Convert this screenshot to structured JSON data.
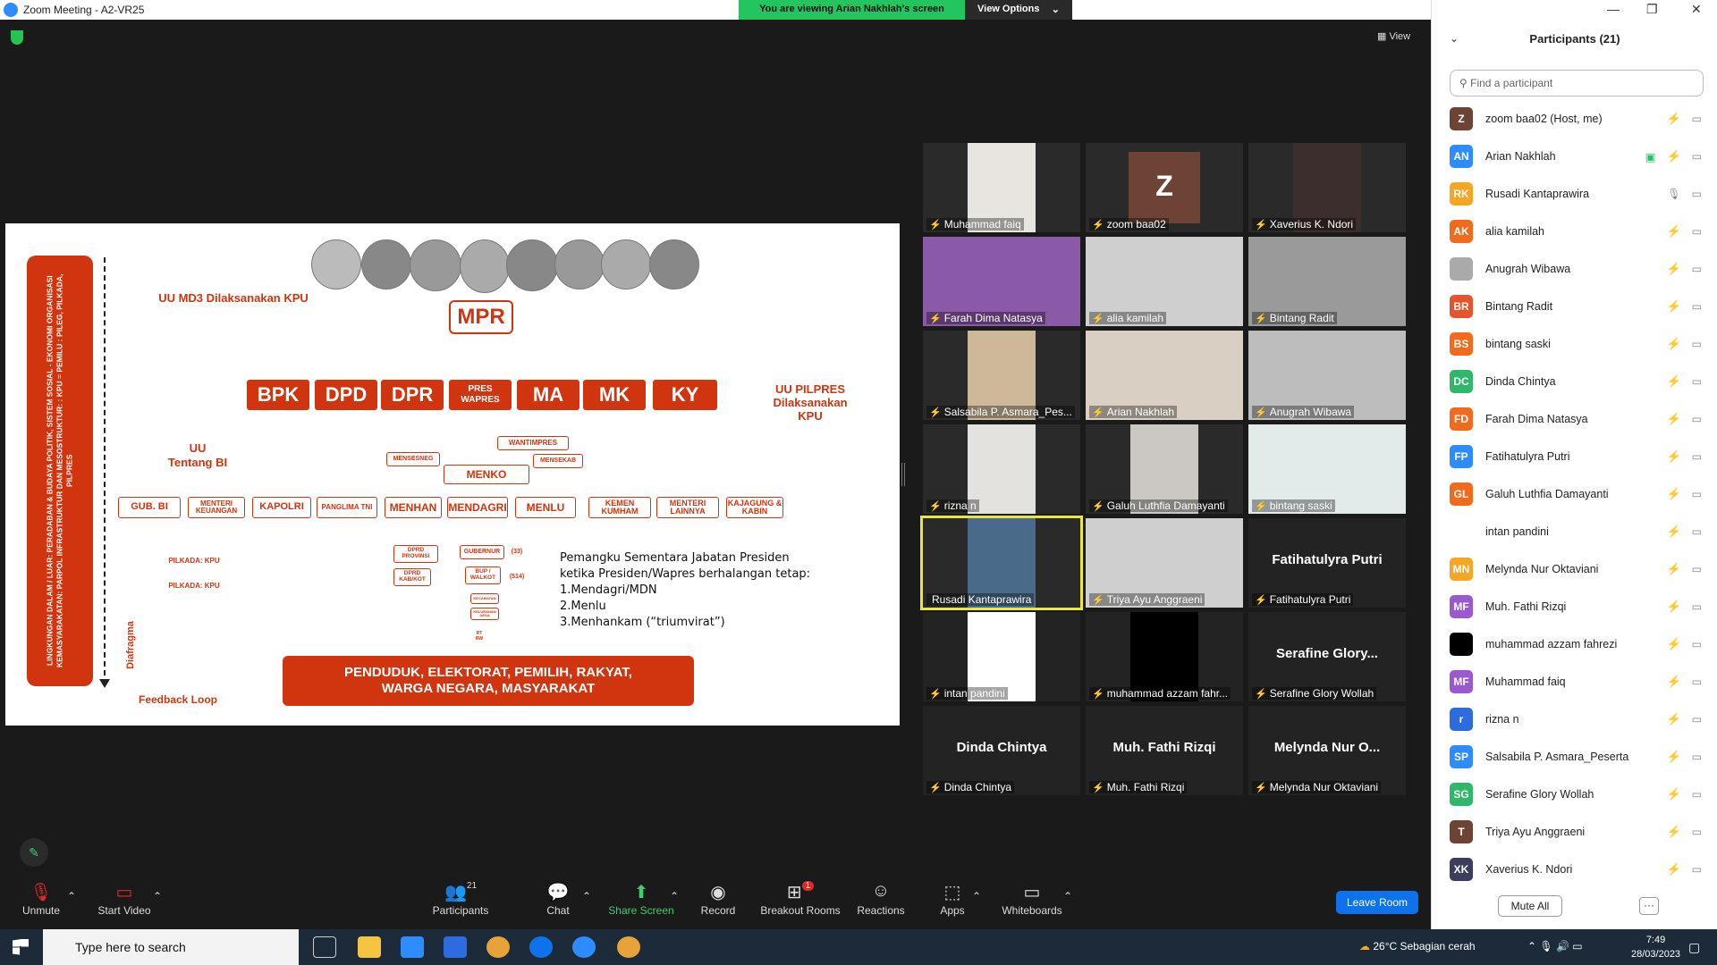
{
  "window": {
    "title": "Zoom Meeting - A2-VR25"
  },
  "banner": {
    "viewing": "You are viewing Arian Nakhlah's screen",
    "view_options": "View Options"
  },
  "view_label": "View",
  "slide": {
    "sideband": "LINGKUNGAN DALAM / LUAR: PERADABAN & BUDAYA POLITIK, SISTEM SOSIAL - EKONOMI ORGANISASI KEMASYARAKATAN: PARPOL INFRASTRUKTUR DAN MESOSTRUKTUR: : KPU = PEMILU : PILEG, PILKADA, PILPRES",
    "uu_md3": "UU MD3 Dilaksanakan KPU",
    "mpr": "MPR",
    "institutions": [
      "BPK",
      "DPD",
      "DPR",
      "PRES WAPRES",
      "MA",
      "MK",
      "KY"
    ],
    "uu_pilpres": "UU PILPRES Dilaksanakan KPU",
    "uu_bi": "UU Tentang BI",
    "wantimpres": "WANTIMPRES",
    "mensesneg": "MENSESNEG",
    "mensekab": "MENSEKAB",
    "menko": "MENKO",
    "row": [
      "GUB. BI",
      "MENTERI KEUANGAN",
      "KAPOLRI",
      "PANGLIMA TNI",
      "MENHAN",
      "MENDAGRI",
      "MENLU",
      "KEMEN KUMHAM",
      "MENTERI LAINNYA",
      "KAJAGUNG & KABIN"
    ],
    "pilkada1": "PILKADA: KPU",
    "pilkada2": "PILKADA: KPU",
    "dprd_prov": "DPRD PROVINSI",
    "dprd_kab": "DPRD KAB/KOT",
    "gubernur": "GUBERNUR",
    "gub_count": "(33)",
    "bupati": "BUP / WALKOT",
    "bup_count": "(514)",
    "kecamatan": "KECAMATAN",
    "kelurahan": "KELURAHAN DESA",
    "rt_rw": "RT RW",
    "pemangku": [
      "Pemangku Sementara Jabatan Presiden",
      "ketika Presiden/Wapres berhalangan tetap:",
      "1.Mendagri/MDN",
      "2.Menlu",
      "3.Menhankam (“triumvirat”)"
    ],
    "diafragma": "Diafragma",
    "feedback": "Feedback Loop",
    "penduduk": "PENDUDUK, ELEKTORAT, PEMILIH, RAKYAT, WARGA NEGARA, MASYARAKAT"
  },
  "tiles": [
    {
      "name": "Muhammad faiq",
      "big": "",
      "bg": "#2a2a2a",
      "vid": "#e8e4e0"
    },
    {
      "name": "zoom baa02",
      "big": "Z",
      "bg": "#2a2a2a",
      "vid": "#6d4336"
    },
    {
      "name": "Xaverius K. Ndori",
      "big": "",
      "bg": "#2a2a2a",
      "vid": "#3c2e2c"
    },
    {
      "name": "Farah Dima Natasya",
      "big": "",
      "bg": "#8a5aa8",
      "vid": ""
    },
    {
      "name": "alia kamilah",
      "big": "",
      "bg": "#cfcfcf",
      "vid": ""
    },
    {
      "name": "Bintang Radit",
      "big": "",
      "bg": "#9a9a9a",
      "vid": ""
    },
    {
      "name": "Salsabila P. Asmara_Pes...",
      "big": "",
      "bg": "#2a2a2a",
      "vid": "#cdb89a"
    },
    {
      "name": "Arian Nakhlah",
      "big": "",
      "bg": "#d9cfc2",
      "vid": ""
    },
    {
      "name": "Anugrah Wibawa",
      "big": "",
      "bg": "#bdbdbd",
      "vid": ""
    },
    {
      "name": "rizna n",
      "big": "",
      "bg": "#2a2a2a",
      "vid": "#e4e2de"
    },
    {
      "name": "Galuh Luthfia Damayanti",
      "big": "",
      "bg": "#2a2a2a",
      "vid": "#cbc8c4"
    },
    {
      "name": "bintang saski",
      "big": "",
      "bg": "#e2eaea",
      "vid": ""
    },
    {
      "name": "Rusadi Kantaprawira",
      "big": "",
      "bg": "#2a2a2a",
      "vid": "#4a6a8a"
    },
    {
      "name": "Triya Ayu Anggraeni",
      "big": "",
      "bg": "#cfcfcf",
      "vid": ""
    },
    {
      "name": "Fatihatulyra Putri",
      "big": "Fatihatulyra Putri",
      "bg": "#232323",
      "vid": ""
    },
    {
      "name": "intan pandini",
      "big": "",
      "bg": "#232323",
      "vid": "#ffffff"
    },
    {
      "name": "muhammad azzam fahr...",
      "big": "",
      "bg": "#232323",
      "vid": "#000000"
    },
    {
      "name": "Serafine Glory Wollah",
      "big": "Serafine Glory...",
      "bg": "#232323",
      "vid": ""
    },
    {
      "name": "Dinda Chintya",
      "big": "Dinda Chintya",
      "bg": "#232323",
      "vid": ""
    },
    {
      "name": "Muh. Fathi Rizqi",
      "big": "Muh. Fathi Rizqi",
      "bg": "#232323",
      "vid": ""
    },
    {
      "name": "Melynda Nur Oktaviani",
      "big": "Melynda Nur O...",
      "bg": "#232323",
      "vid": ""
    }
  ],
  "toolbar": {
    "unmute": "Unmute",
    "start_video": "Start Video",
    "participants": "Participants",
    "participants_count": "21",
    "chat": "Chat",
    "share_screen": "Share Screen",
    "record": "Record",
    "breakout": "Breakout Rooms",
    "breakout_badge": "1",
    "reactions": "Reactions",
    "apps": "Apps",
    "whiteboards": "Whiteboards",
    "leave": "Leave Room"
  },
  "panel": {
    "title": "Participants (21)",
    "find_placeholder": "Find a participant",
    "mute_all": "Mute All",
    "more": "···",
    "participants": [
      {
        "initials": "Z",
        "name": "zoom baa02 (Host, me)",
        "color": "#6d4336"
      },
      {
        "initials": "AN",
        "name": "Arian Nakhlah",
        "color": "#2d8cff"
      },
      {
        "initials": "RK",
        "name": "Rusadi Kantaprawira",
        "color": "#f5a623"
      },
      {
        "initials": "AK",
        "name": "alia kamilah",
        "color": "#f26b1d"
      },
      {
        "initials": "",
        "name": "Anugrah Wibawa",
        "color": "#aaaaaa"
      },
      {
        "initials": "BR",
        "name": "Bintang Radit",
        "color": "#e8532e"
      },
      {
        "initials": "BS",
        "name": "bintang saski",
        "color": "#f26b1d"
      },
      {
        "initials": "DC",
        "name": "Dinda Chintya",
        "color": "#2fb86a"
      },
      {
        "initials": "FD",
        "name": "Farah Dima Natasya",
        "color": "#f26b1d"
      },
      {
        "initials": "FP",
        "name": "Fatihatulyra Putri",
        "color": "#2d8cff"
      },
      {
        "initials": "GL",
        "name": "Galuh Luthfia Damayanti",
        "color": "#f26b1d"
      },
      {
        "initials": "",
        "name": "intan pandini",
        "color": "#ffffff"
      },
      {
        "initials": "MN",
        "name": "Melynda Nur Oktaviani",
        "color": "#f5a623"
      },
      {
        "initials": "MF",
        "name": "Muh. Fathi Rizqi",
        "color": "#9b59d0"
      },
      {
        "initials": "",
        "name": "muhammad azzam fahrezi",
        "color": "#000000"
      },
      {
        "initials": "MF",
        "name": "Muhammad faiq",
        "color": "#9b59d0"
      },
      {
        "initials": "r",
        "name": "rizna n",
        "color": "#2d6cdf"
      },
      {
        "initials": "SP",
        "name": "Salsabila P. Asmara_Peserta",
        "color": "#2d8cff"
      },
      {
        "initials": "SG",
        "name": "Serafine Glory Wollah",
        "color": "#2fb86a"
      },
      {
        "initials": "T",
        "name": "Triya Ayu Anggraeni",
        "color": "#6d4336"
      },
      {
        "initials": "XK",
        "name": "Xaverius K. Ndori",
        "color": "#3b3f5c"
      }
    ]
  },
  "taskbar": {
    "search": "Type here to search",
    "weather": "26°C  Sebagian cerah",
    "time": "7:49",
    "date": "28/03/2023"
  }
}
